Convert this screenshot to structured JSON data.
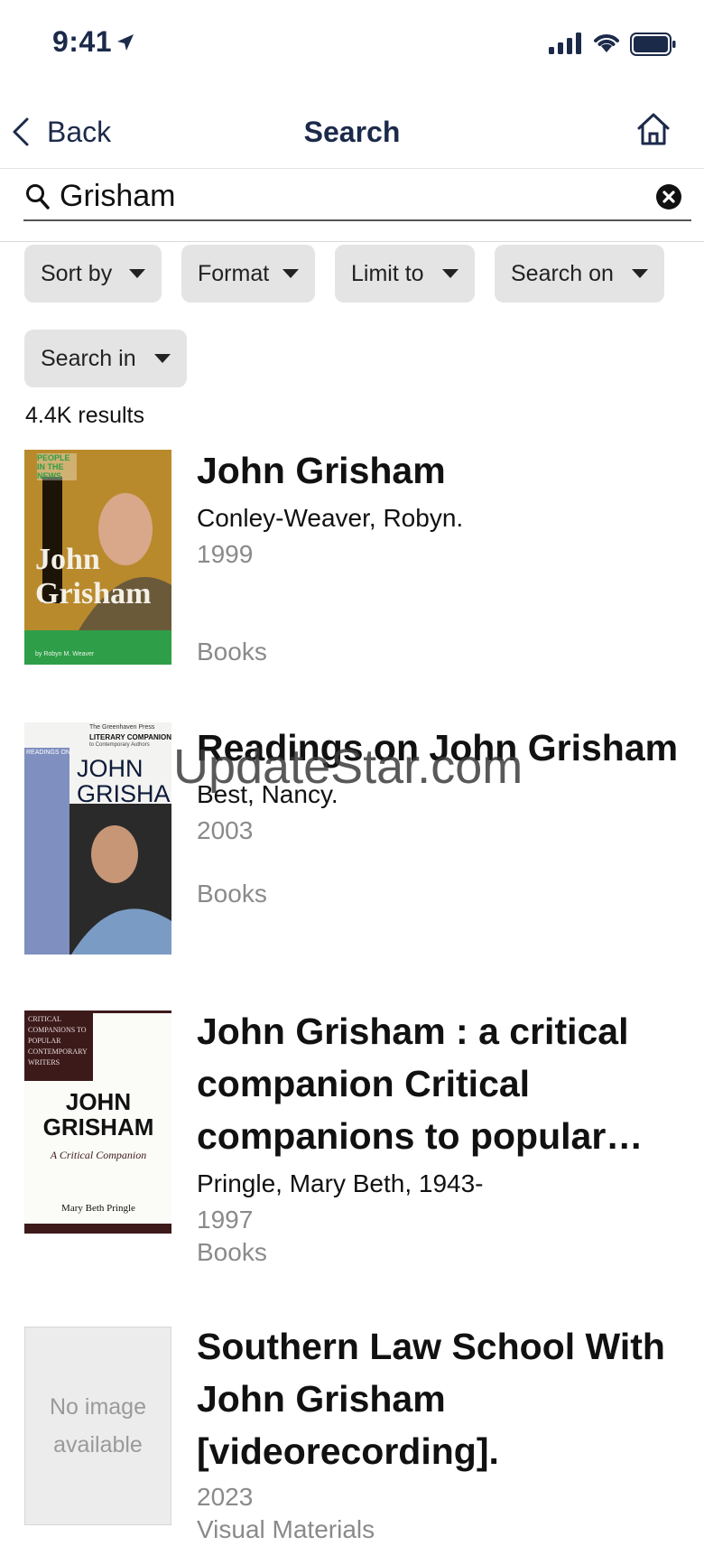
{
  "status": {
    "time": "9:41"
  },
  "nav": {
    "back_label": "Back",
    "title": "Search"
  },
  "search": {
    "value": "Grisham"
  },
  "filters": [
    {
      "label": "Sort by"
    },
    {
      "label": "Format"
    },
    {
      "label": "Limit to"
    },
    {
      "label": "Search on"
    },
    {
      "label": "Search in"
    }
  ],
  "results_count": "4.4K results",
  "results": [
    {
      "title": "John Grisham",
      "author": "Conley-Weaver, Robyn.",
      "year": "1999",
      "type": "Books",
      "cover": {
        "series": "PEOPLE IN THE NEWS",
        "title_line1": "John",
        "title_line2": "Grisham",
        "byline": "by Robyn M. Weaver"
      }
    },
    {
      "title": "Readings on John Grisham",
      "author": "Best, Nancy.",
      "year": "2003",
      "type": "Books",
      "cover": {
        "top": "The Greenhaven Press",
        "series": "LITERARY COMPANION",
        "sub": "to Contemporary Authors",
        "side": "READINGS ON",
        "title_line1": "JOHN",
        "title_line2": "GRISHAM"
      }
    },
    {
      "title": "John Grisham : a critical companion Critical companions to popular…",
      "author": "Pringle, Mary Beth, 1943-",
      "year": "1997",
      "type": "Books",
      "cover": {
        "series": "CRITICAL COMPANIONS TO POPULAR CONTEMPORARY WRITERS",
        "title_line1": "JOHN",
        "title_line2": "GRISHAM",
        "subtitle": "A Critical Companion",
        "author": "Mary Beth Pringle"
      }
    },
    {
      "title": "Southern Law School With John Grisham [videorecording].",
      "author": "",
      "year": "2023",
      "type": "Visual Materials",
      "cover": {
        "placeholder": "No image available"
      }
    }
  ],
  "watermark": "UpdateStar.com",
  "colors": {
    "nav_text": "#1c2a4a",
    "chip_bg": "#e4e4e4",
    "meta_gray": "#8a8a8a"
  }
}
